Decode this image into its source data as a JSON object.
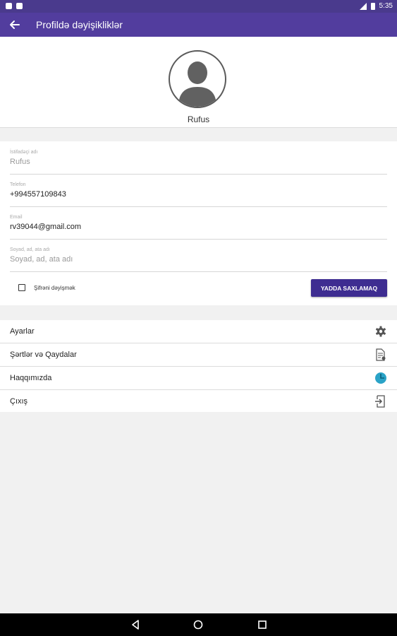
{
  "status_bar": {
    "time": "5:35"
  },
  "app_bar": {
    "title": "Profildə dəyişikliklər"
  },
  "profile": {
    "name": "Rufus"
  },
  "form": {
    "fields": [
      {
        "label": "İstifadəçi adı",
        "value": "Rufus",
        "muted": true
      },
      {
        "label": "Telefon",
        "value": "+994557109843",
        "muted": false
      },
      {
        "label": "Email",
        "value": "rv39044@gmail.com",
        "muted": false
      },
      {
        "label": "Soyad, ad, ata adı",
        "value": "Soyad, ad, ata adı",
        "muted": true
      }
    ],
    "change_password_label": "Şifrəni dəyişmək",
    "change_password_checked": false,
    "save_label": "YADDA SAXLAMAQ"
  },
  "menu": {
    "items": [
      {
        "label": "Ayarlar",
        "icon": "gear-icon"
      },
      {
        "label": "Şərtlər və Qaydalar",
        "icon": "document-icon"
      },
      {
        "label": "Haqqımızda",
        "icon": "info-circle-icon"
      },
      {
        "label": "Çıxış",
        "icon": "exit-icon"
      }
    ]
  },
  "colors": {
    "primary": "#523d9e",
    "button": "#3e2d91",
    "about_icon": "#2aa3c7"
  }
}
